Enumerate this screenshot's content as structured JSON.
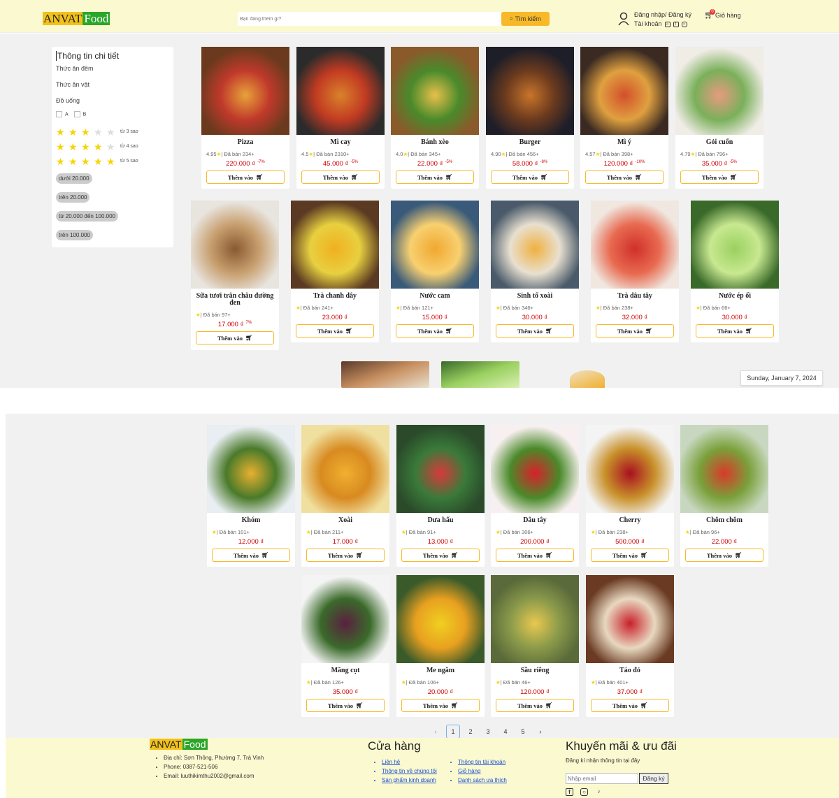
{
  "header": {
    "logo_anvat": "ANVAT",
    "logo_food": "Food",
    "search_placeholder": "Bạn đang thèm gì?",
    "search_button": "Tìm kiếm",
    "login_label": "Đăng nhập/ Đăng ký",
    "account_label": "Tài khoản",
    "cart_label": "Giỏ hàng",
    "cart_count": "0"
  },
  "sidebar": {
    "title": "Thông tin chi tiết",
    "categories": [
      "Thức ăn đêm",
      "Thức ăn vặt",
      "Đồ uống"
    ],
    "checkbox_a": "A",
    "checkbox_b": "B",
    "ratings": [
      {
        "stars": 3,
        "label": "từ 3 sao"
      },
      {
        "stars": 4,
        "label": "từ 4 sao"
      },
      {
        "stars": 5,
        "label": "từ 5 sao"
      }
    ],
    "price_filters": [
      "dưới 20.000",
      "trên 20.000",
      "từ 20.000 đến 100.000",
      "trên 100.000"
    ]
  },
  "add_label": "Thêm vào",
  "foods": [
    {
      "name": "Pizza",
      "rating": "4.95",
      "sold": "| Đã bán 234+",
      "price": "220.000 ₫",
      "discount": "-7%",
      "colors": [
        "#6b3a1e",
        "#e8a23a",
        "#c0392b"
      ]
    },
    {
      "name": "Mì cay",
      "rating": "4.5",
      "sold": "| Đã bán 2310+",
      "price": "45.000 ₫",
      "discount": "-5%",
      "colors": [
        "#2b2b2b",
        "#d9822b",
        "#c23b22"
      ]
    },
    {
      "name": "Bánh xèo",
      "rating": "4.0",
      "sold": "| Đã bán 345+",
      "price": "22.000 ₫",
      "discount": "-5%",
      "colors": [
        "#8a5a2b",
        "#e8c04a",
        "#4a8a2b"
      ]
    },
    {
      "name": "Burger",
      "rating": "4.90",
      "sold": "| Đã bán 456+",
      "price": "58.000 ₫",
      "discount": "-8%",
      "colors": [
        "#1e1e28",
        "#c8752a",
        "#6b3a1e"
      ]
    },
    {
      "name": "Mì ý",
      "rating": "4.57",
      "sold": "| Đã bán 398+",
      "price": "120.000 ₫",
      "discount": "-10%",
      "colors": [
        "#3a2a22",
        "#d2502a",
        "#e0a040"
      ]
    },
    {
      "name": "Gỏi cuốn",
      "rating": "4.79",
      "sold": "| Đã bán 796+",
      "price": "35.000 ₫",
      "discount": "-5%",
      "colors": [
        "#f0ece6",
        "#e89a80",
        "#7ab05a"
      ]
    }
  ],
  "drinks": [
    {
      "name": "Sữa tươi trân châu đường đen",
      "sold": "| Đã bán 97+",
      "price": "17.000 ₫",
      "discount": "7%",
      "colors": [
        "#e8e4de",
        "#8a5a30",
        "#c8a070"
      ]
    },
    {
      "name": "Trà chanh dây",
      "sold": "| Đã bán 241+",
      "price": "23.000 ₫",
      "discount": "",
      "colors": [
        "#5a3a22",
        "#f0b020",
        "#e8d040"
      ]
    },
    {
      "name": "Nước cam",
      "sold": "| Đã bán 121+",
      "price": "15.000 ₫",
      "discount": "",
      "colors": [
        "#3a5a7a",
        "#f0a830",
        "#f8d070"
      ]
    },
    {
      "name": "Sinh tố xoài",
      "sold": "| Đã bán 346+",
      "price": "30.000 ₫",
      "discount": "",
      "colors": [
        "#4a5a6a",
        "#f0b040",
        "#e8e0d0"
      ]
    },
    {
      "name": "Trà dâu tây",
      "sold": "| Đã bán 238+",
      "price": "32.000 ₫",
      "discount": "",
      "colors": [
        "#f0e8e0",
        "#d0302a",
        "#e86a50"
      ]
    },
    {
      "name": "Nước ép ổi",
      "sold": "| Đã bán 66+",
      "price": "30.000 ₫",
      "discount": "",
      "colors": [
        "#3a6a2a",
        "#9ad060",
        "#c8e890"
      ]
    }
  ],
  "fruits": [
    {
      "name": "Khóm",
      "sold": "| Đã bán 101+",
      "price": "12.000 ₫",
      "colors": [
        "#e8eef2",
        "#e8b030",
        "#4a7a2a"
      ]
    },
    {
      "name": "Xoài",
      "sold": "| Đã bán 211+",
      "price": "17.000 ₫",
      "colors": [
        "#f0e0a0",
        "#f0b030",
        "#d88a20"
      ]
    },
    {
      "name": "Dưa hấu",
      "sold": "| Đã bán 91+",
      "price": "13.000 ₫",
      "colors": [
        "#2a4a2a",
        "#d83a3a",
        "#3a7a3a"
      ]
    },
    {
      "name": "Dâu tây",
      "sold": "| Đã bán 306+",
      "price": "200.000 ₫",
      "colors": [
        "#f8f0f0",
        "#d8202a",
        "#4a8a2a"
      ]
    },
    {
      "name": "Cherry",
      "sold": "| Đã bán 238+",
      "price": "500.000 ₫",
      "colors": [
        "#f4f4f4",
        "#a81020",
        "#c8902a"
      ]
    },
    {
      "name": "Chôm chôm",
      "sold": "| Đã bán 96+",
      "price": "22.000 ₫",
      "colors": [
        "#c8d8c0",
        "#d83a2a",
        "#7aa03a"
      ]
    },
    {
      "name": "Măng cụt",
      "sold": "| Đã bán 126+",
      "price": "35.000 ₫",
      "colors": [
        "#f4f4f4",
        "#5a2040",
        "#3a6a2a"
      ]
    },
    {
      "name": "Me ngâm",
      "sold": "| Đã bán 106+",
      "price": "20.000 ₫",
      "colors": [
        "#3a5a2a",
        "#f0d020",
        "#e8a020"
      ]
    },
    {
      "name": "Sầu riêng",
      "sold": "| Đã bán 46+",
      "price": "120.000 ₫",
      "colors": [
        "#5a6a3a",
        "#e8c850",
        "#8a9a4a"
      ]
    },
    {
      "name": "Táo đỏ",
      "sold": "| Đã bán 401+",
      "price": "37.000 ₫",
      "colors": [
        "#6a3a22",
        "#c8202a",
        "#e8d8c0"
      ]
    }
  ],
  "date_label": "Sunday, January 7, 2024",
  "pagination": [
    "1",
    "2",
    "3",
    "4",
    "5"
  ],
  "footer": {
    "address": "Địa chỉ: Sơn Thông, Phường 7, Trà Vinh",
    "phone": "Phone: 0387-521-506",
    "email": "Email: luuthikimthu2002@gmail.com",
    "store_title": "Cửa hàng",
    "store_links_left": [
      "Liên hệ",
      "Thông tin về chúng tôi",
      "Sản phẩm kinh doanh"
    ],
    "store_links_right": [
      "Thông tin tài khoản",
      "Giỏ hàng",
      "Danh sách ưa thích"
    ],
    "promo_title": "Khuyến mãi & ưu đãi",
    "promo_sub": "Đăng kí nhận thông tin tại đây",
    "email_placeholder": "Nhập email",
    "subscribe_button": "Đăng ký"
  }
}
